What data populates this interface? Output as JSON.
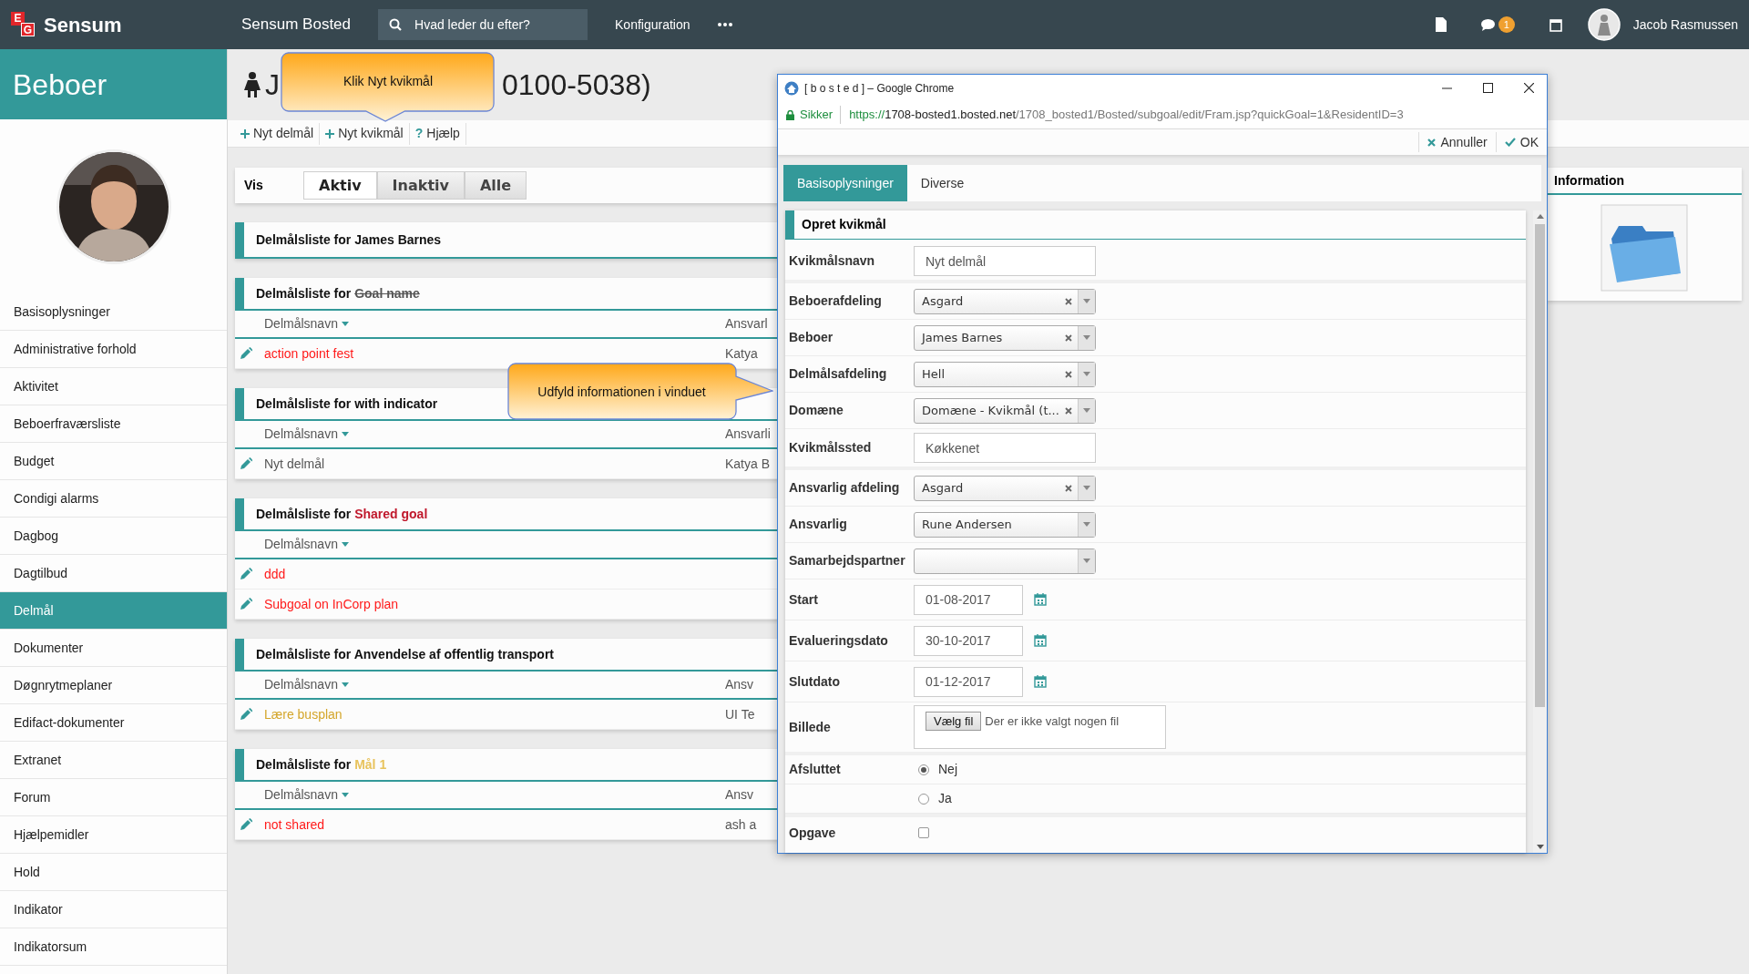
{
  "topbar": {
    "logo_letters": [
      "E",
      "G"
    ],
    "brand": "Sensum",
    "app_title": "Sensum Bosted",
    "search": {
      "placeholder": "Hvad leder du efter?"
    },
    "menu": [
      "Konfiguration"
    ],
    "chat_badge": "1",
    "user": "Jacob Rasmussen"
  },
  "sidebar": {
    "title": "Beboer",
    "items": [
      {
        "label": "Basisoplysninger",
        "selected": false
      },
      {
        "label": "Administrative forhold",
        "selected": false
      },
      {
        "label": "Aktivitet",
        "selected": false
      },
      {
        "label": "Beboerfraværsliste",
        "selected": false
      },
      {
        "label": "Budget",
        "selected": false
      },
      {
        "label": "Condigi alarms",
        "selected": false
      },
      {
        "label": "Dagbog",
        "selected": false
      },
      {
        "label": "Dagtilbud",
        "selected": false
      },
      {
        "label": "Delmål",
        "selected": true
      },
      {
        "label": "Dokumenter",
        "selected": false
      },
      {
        "label": "Døgnrytmeplaner",
        "selected": false
      },
      {
        "label": "Edifact-dokumenter",
        "selected": false
      },
      {
        "label": "Extranet",
        "selected": false
      },
      {
        "label": "Forum",
        "selected": false
      },
      {
        "label": "Hjælpemidler",
        "selected": false
      },
      {
        "label": "Hold",
        "selected": false
      },
      {
        "label": "Indikator",
        "selected": false
      },
      {
        "label": "Indikatorsum",
        "selected": false
      }
    ]
  },
  "page": {
    "title_start": "J",
    "title_end": "0100-5038)",
    "actions": [
      {
        "kind": "add",
        "label": "Nyt delmål"
      },
      {
        "kind": "add",
        "label": "Nyt kvikmål"
      },
      {
        "kind": "help",
        "symbol": "?",
        "label": "Hjælp"
      }
    ]
  },
  "filter": {
    "label": "Vis",
    "options": [
      {
        "label": "Aktiv",
        "selected": true
      },
      {
        "label": "Inaktiv",
        "selected": false
      },
      {
        "label": "Alle",
        "selected": false
      }
    ]
  },
  "lists": [
    {
      "prefix": "Delmålsliste for",
      "subject": "James Barnes",
      "struck": false
    },
    {
      "prefix": "Delmålsliste for",
      "subject": "Goal name",
      "struck": true,
      "columns": {
        "name": "Delmålsnavn",
        "column_2": "Ansvarl"
      },
      "rows": [
        {
          "name": "action point fest",
          "color": "#ff1a1a",
          "column_2": "Katya"
        }
      ]
    },
    {
      "prefix": "Delmålsliste for",
      "subject": "with indicator",
      "struck": false,
      "columns": {
        "name": "Delmålsnavn",
        "column_2": "Ansvarli"
      },
      "rows": [
        {
          "name": "Nyt delmål",
          "color": "#555555",
          "column_2": "Katya B"
        }
      ]
    },
    {
      "prefix": "Delmålsliste for",
      "subject": "Shared goal",
      "struck": false,
      "color": "#c0182c",
      "columns": {
        "name": "Delmålsnavn"
      },
      "rows": [
        {
          "name": "ddd",
          "color": "#ff1a1a"
        },
        {
          "name": "Subgoal on InCorp plan",
          "color": "#ff1a1a"
        }
      ]
    },
    {
      "prefix": "Delmålsliste for",
      "subject": "Anvendelse af offentlig transport",
      "struck": false,
      "columns": {
        "name": "Delmålsnavn",
        "column_2": "Ansv"
      },
      "rows": [
        {
          "name": "Lære busplan",
          "color": "#d4a62a",
          "column_2": "UI Te"
        }
      ]
    },
    {
      "prefix": "Delmålsliste for",
      "subject": "Mål 1",
      "struck": false,
      "color": "#e8c35c",
      "columns": {
        "name": "Delmålsnavn",
        "column_2": "Ansv"
      },
      "rows": [
        {
          "name": "not shared",
          "color": "#ff1a1a",
          "column_2": "ash a"
        }
      ]
    }
  ],
  "info_panel": {
    "title": "Information"
  },
  "callouts": [
    {
      "kind": "down",
      "text": "Klik Nyt kvikmål"
    },
    {
      "kind": "right",
      "text": "Udfyld informationen i vinduet"
    }
  ],
  "dialog": {
    "title": "[ b o s t e d ] – Google Chrome",
    "security": "Sikker",
    "url": {
      "scheme": "https://",
      "host": "1708-bosted1.bosted.net",
      "path": "/1708_bosted1/Bosted/subgoal/edit/Fram.jsp?quickGoal=1&ResidentID=3"
    },
    "actions": [
      {
        "kind": "cancel",
        "label": "Annuller"
      },
      {
        "kind": "ok",
        "label": "OK"
      }
    ],
    "tabs": [
      {
        "label": "Basisoplysninger",
        "selected": true
      },
      {
        "label": "Diverse",
        "selected": false
      }
    ],
    "form": {
      "title": "Opret kvikmål",
      "fields": [
        {
          "kind": "text",
          "label": "Kvikmålsnavn",
          "value": "Nyt delmål"
        },
        {
          "kind": "select",
          "label": "Beboerafdeling",
          "value": "Asgard",
          "clearable": true
        },
        {
          "kind": "select",
          "label": "Beboer",
          "value": "James Barnes",
          "clearable": true
        },
        {
          "kind": "select",
          "label": "Delmålsafdeling",
          "value": "Hell",
          "clearable": true
        },
        {
          "kind": "select",
          "label": "Domæne",
          "value": "Domæne - Kvikmål (t...",
          "clearable": true
        },
        {
          "kind": "text",
          "label": "Kvikmålssted",
          "value": "Køkkenet"
        },
        {
          "kind": "select",
          "label": "Ansvarlig afdeling",
          "value": "Asgard",
          "clearable": true
        },
        {
          "kind": "select",
          "label": "Ansvarlig",
          "value": "Rune Andersen",
          "clearable": false
        },
        {
          "kind": "select",
          "label": "Samarbejdspartner",
          "clearable": false
        },
        {
          "kind": "date",
          "label": "Start",
          "value": "01-08-2017"
        },
        {
          "kind": "date",
          "label": "Evalueringsdato",
          "value": "30-10-2017"
        },
        {
          "kind": "date",
          "label": "Slutdato",
          "value": "01-12-2017"
        },
        {
          "kind": "file",
          "label": "Billede",
          "button": "Vælg fil",
          "status": "Der er ikke valgt nogen fil"
        },
        {
          "kind": "radio",
          "label": "Afsluttet",
          "options": [
            {
              "label": "Nej",
              "selected": true
            },
            {
              "label": "Ja",
              "selected": false
            }
          ]
        },
        {
          "kind": "checkbox",
          "label": "Opgave",
          "checked": false
        }
      ]
    }
  }
}
